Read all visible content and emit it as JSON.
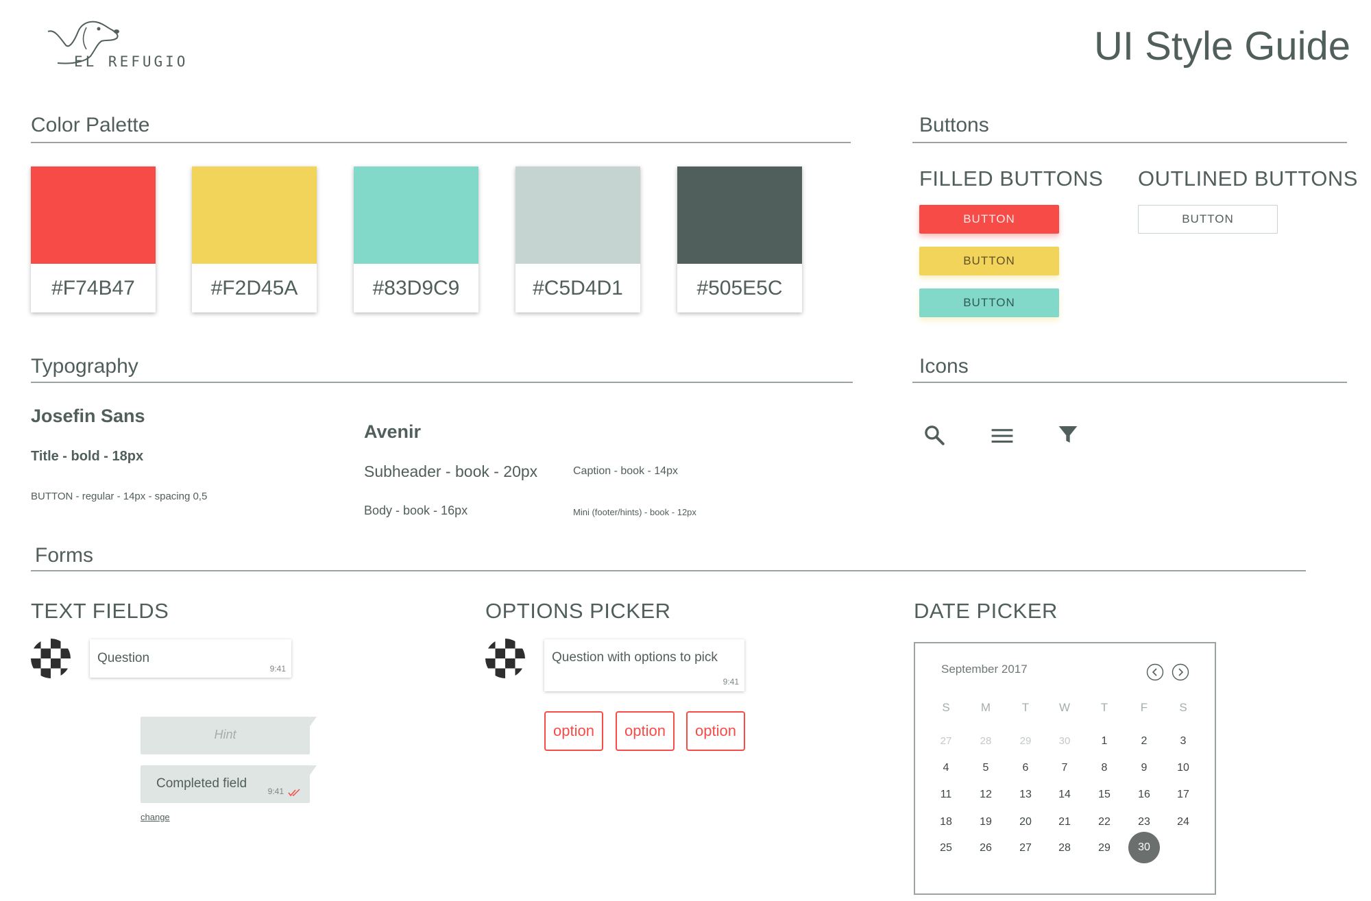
{
  "header": {
    "brand": "EL REFUGIO",
    "title": "UI Style Guide"
  },
  "sections": {
    "color_palette": "Color Palette",
    "buttons": "Buttons",
    "typography": "Typography",
    "icons": "Icons",
    "forms": "Forms"
  },
  "palette": [
    {
      "hex": "#F74B47",
      "label": "#F74B47"
    },
    {
      "hex": "#F2D45A",
      "label": "#F2D45A"
    },
    {
      "hex": "#83D9C9",
      "label": "#83D9C9"
    },
    {
      "hex": "#C5D4D1",
      "label": "#C5D4D1"
    },
    {
      "hex": "#505E5C",
      "label": "#505E5C"
    }
  ],
  "buttons": {
    "filled_title": "FILLED BUTTONS",
    "outlined_title": "OUTLINED BUTTONS",
    "filled": [
      {
        "label": "BUTTON",
        "color": "#F74B47"
      },
      {
        "label": "BUTTON",
        "color": "#F2D45A"
      },
      {
        "label": "BUTTON",
        "color": "#83D9C9"
      }
    ],
    "outlined": [
      {
        "label": "BUTTON"
      }
    ]
  },
  "typography": {
    "font1": "Josefin Sans",
    "font1_title": "Title - bold - 18px",
    "font1_button": "BUTTON - regular - 14px - spacing 0,5",
    "font2": "Avenir",
    "subheader": "Subheader - book - 20px",
    "body": "Body - book - 16px",
    "caption": "Caption - book - 14px",
    "mini": "Mini (footer/hints) - book - 12px"
  },
  "icons": [
    {
      "name": "search-icon"
    },
    {
      "name": "menu-icon"
    },
    {
      "name": "filter-icon"
    }
  ],
  "forms": {
    "text_fields": {
      "title": "TEXT FIELDS",
      "question": "Question",
      "question_time": "9:41",
      "hint": "Hint",
      "completed": "Completed field",
      "completed_time": "9:41",
      "change": "change"
    },
    "options_picker": {
      "title": "OPTIONS PICKER",
      "question": "Question with options to pick",
      "question_time": "9:41",
      "options": [
        "option",
        "option",
        "option"
      ]
    },
    "date_picker": {
      "title": "DATE PICKER",
      "month": "September 2017",
      "weekdays": [
        "S",
        "M",
        "T",
        "W",
        "T",
        "F",
        "S"
      ],
      "weeks": [
        [
          "27",
          "28",
          "29",
          "30",
          "1",
          "2",
          "3"
        ],
        [
          "4",
          "5",
          "6",
          "7",
          "8",
          "9",
          "10"
        ],
        [
          "11",
          "12",
          "13",
          "14",
          "15",
          "16",
          "17"
        ],
        [
          "18",
          "19",
          "20",
          "21",
          "22",
          "23",
          "24"
        ],
        [
          "25",
          "26",
          "27",
          "28",
          "29",
          "30",
          ""
        ]
      ],
      "selected": "30"
    }
  }
}
